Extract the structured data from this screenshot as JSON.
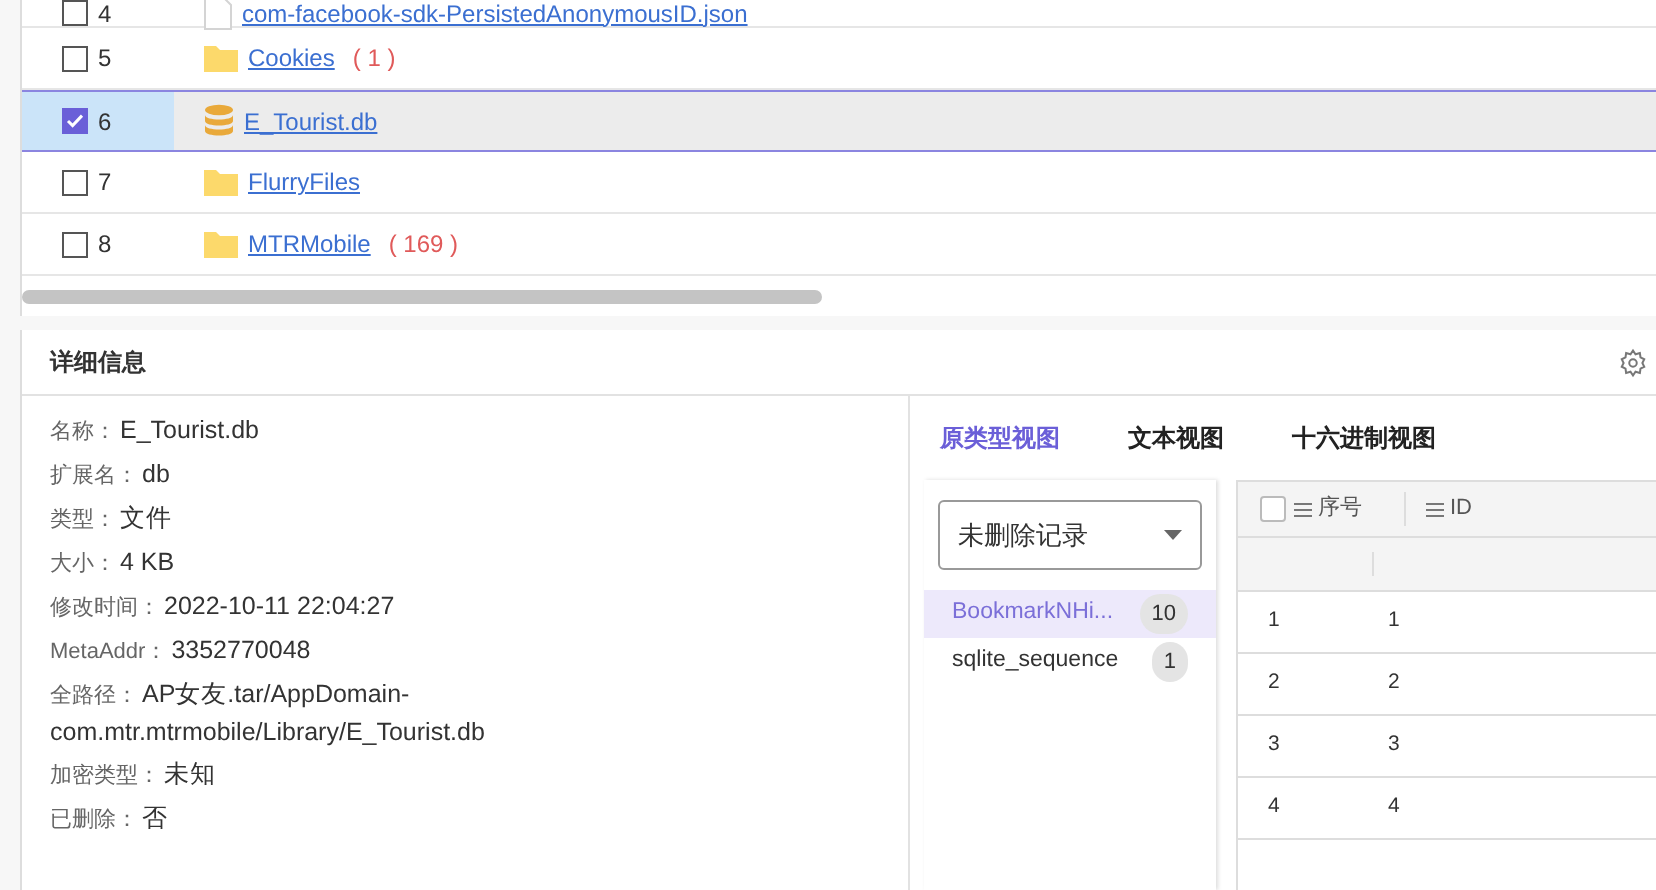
{
  "files": [
    {
      "index": "4",
      "name": "com-facebook-sdk-PersistedAnonymousID.json",
      "kind": "file",
      "checked": false,
      "selected": false
    },
    {
      "index": "5",
      "name": "Cookies",
      "count": "( 1 )",
      "kind": "folder",
      "checked": false,
      "selected": false
    },
    {
      "index": "6",
      "name": "E_Tourist.db",
      "kind": "database",
      "checked": true,
      "selected": true
    },
    {
      "index": "7",
      "name": "FlurryFiles",
      "kind": "folder",
      "checked": false,
      "selected": false
    },
    {
      "index": "8",
      "name": "MTRMobile",
      "count": "( 169 )",
      "kind": "folder",
      "checked": false,
      "selected": false
    }
  ],
  "details": {
    "title": "详细信息",
    "fields": [
      {
        "label": "名称：",
        "value": "E_Tourist.db"
      },
      {
        "label": "扩展名：",
        "value": "db"
      },
      {
        "label": "类型：",
        "value": "文件"
      },
      {
        "label": "大小：",
        "value": "4 KB"
      },
      {
        "label": "修改时间：",
        "value": "2022-10-11 22:04:27"
      },
      {
        "label": "MetaAddr：",
        "value": "3352770048"
      },
      {
        "label": "全路径：",
        "value": "AP女友.tar/AppDomain-com.mtr.mtrmobile/Library/E_Tourist.db"
      },
      {
        "label": "加密类型：",
        "value": "未知"
      },
      {
        "label": "已删除：",
        "value": "否"
      }
    ]
  },
  "views": {
    "tabs": [
      {
        "label": "原类型视图",
        "selected": true
      },
      {
        "label": "文本视图",
        "selected": false
      },
      {
        "label": "十六进制视图",
        "selected": false
      }
    ],
    "record_filter": {
      "value": "未删除记录"
    },
    "tables": [
      {
        "name": "BookmarkNHi...",
        "count": "10",
        "selected": true
      },
      {
        "name": "sqlite_sequence",
        "count": "1",
        "selected": false
      }
    ],
    "grid": {
      "select_all_checked": false,
      "columns": [
        "序号",
        "ID"
      ],
      "rows": [
        [
          "1",
          "1"
        ],
        [
          "2",
          "2"
        ],
        [
          "3",
          "3"
        ],
        [
          "4",
          "4"
        ]
      ]
    }
  }
}
